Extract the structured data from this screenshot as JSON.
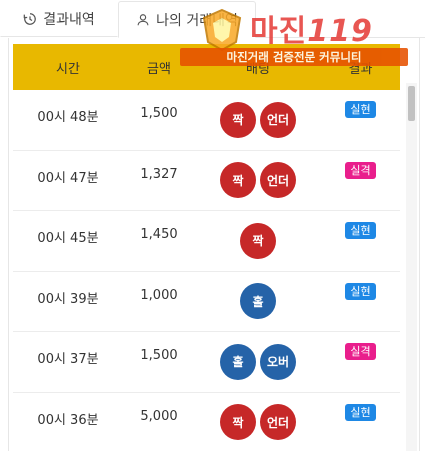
{
  "tabs": [
    {
      "label": "결과내역",
      "icon": "history-icon",
      "active": false
    },
    {
      "label": "나의 거래내역",
      "icon": "user-icon",
      "active": true
    }
  ],
  "table": {
    "headers": {
      "time": "시간",
      "amount": "금액",
      "bet": "배팅",
      "result": "결과"
    },
    "rows": [
      {
        "time": "00시 48분",
        "amount": "1,500",
        "bets": [
          {
            "label": "짝",
            "color": "red"
          },
          {
            "label": "언더",
            "color": "red"
          }
        ],
        "result": "실현",
        "status": "hit"
      },
      {
        "time": "00시 47분",
        "amount": "1,327",
        "bets": [
          {
            "label": "짝",
            "color": "red"
          },
          {
            "label": "언더",
            "color": "red"
          }
        ],
        "result": "실격",
        "status": "miss"
      },
      {
        "time": "00시 45분",
        "amount": "1,450",
        "bets": [
          {
            "label": "짝",
            "color": "red"
          }
        ],
        "result": "실현",
        "status": "hit"
      },
      {
        "time": "00시 39분",
        "amount": "1,000",
        "bets": [
          {
            "label": "홀",
            "color": "blue"
          }
        ],
        "result": "실현",
        "status": "hit"
      },
      {
        "time": "00시 37분",
        "amount": "1,500",
        "bets": [
          {
            "label": "홀",
            "color": "blue"
          },
          {
            "label": "오버",
            "color": "blue"
          }
        ],
        "result": "실격",
        "status": "miss"
      },
      {
        "time": "00시 36분",
        "amount": "5,000",
        "bets": [
          {
            "label": "짝",
            "color": "red"
          },
          {
            "label": "언더",
            "color": "red"
          }
        ],
        "result": "실현",
        "status": "hit"
      }
    ]
  },
  "watermark": {
    "title": "마진",
    "number": "119",
    "banner": "마진거래 검증전문 커뮤니티"
  },
  "colors": {
    "header_bg": "#e8b800",
    "ball_red": "#c62828",
    "ball_blue": "#2563a8",
    "badge_hit": "#1e88e5",
    "badge_miss": "#e91e8c"
  }
}
